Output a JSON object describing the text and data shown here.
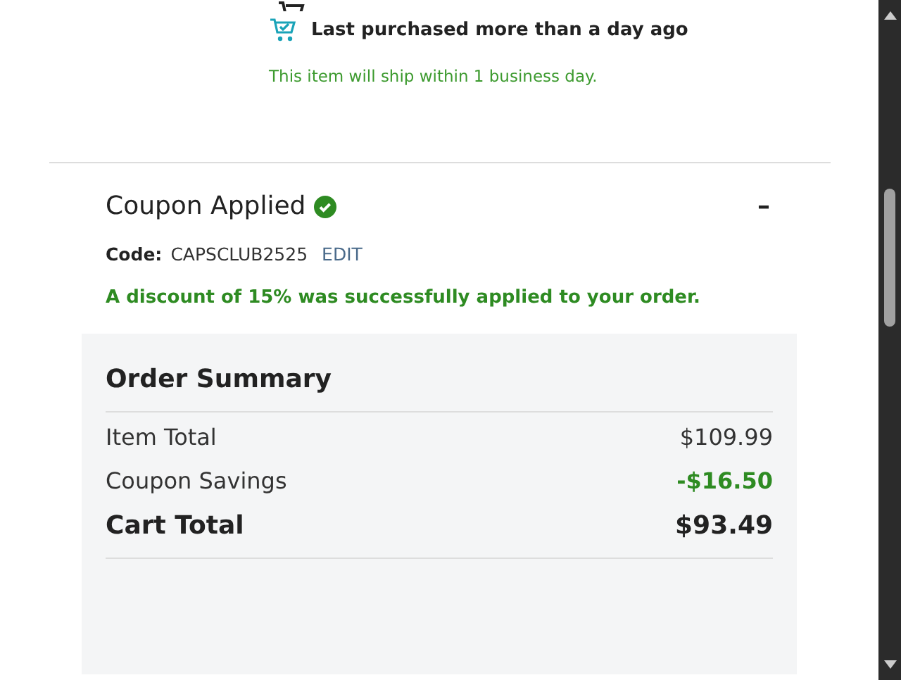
{
  "purchase_note": "Last purchased more than a day ago",
  "shipping_note": "This item will ship within 1 business day.",
  "coupon": {
    "title": "Coupon Applied",
    "applied": true,
    "expanded": true,
    "collapse_symbol": "–",
    "code_label": "Code:",
    "code": "CAPSCLUB2525",
    "edit_link": "EDIT",
    "message": "A discount of 15% was successfully applied to your order."
  },
  "summary": {
    "title": "Order Summary",
    "rows": [
      {
        "kind": "normal",
        "label": "Item Total",
        "value": "$109.99"
      },
      {
        "kind": "savings",
        "label": "Coupon Savings",
        "value": "-$16.50"
      },
      {
        "kind": "total",
        "label": "Cart Total",
        "value": "$93.49"
      }
    ]
  }
}
